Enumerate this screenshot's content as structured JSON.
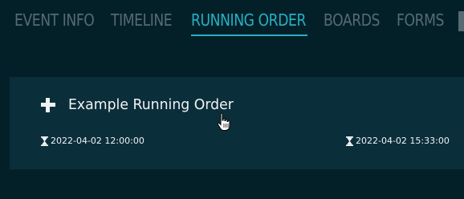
{
  "tabs": [
    {
      "label": "EVENT INFO",
      "active": false
    },
    {
      "label": "TIMELINE",
      "active": false
    },
    {
      "label": "RUNNING ORDER",
      "active": true
    },
    {
      "label": "BOARDS",
      "active": false
    },
    {
      "label": "FORMS",
      "active": false
    }
  ],
  "running_order": {
    "title": "Example Running Order",
    "start_time": "2022-04-02 12:00:00",
    "end_time": "2022-04-02 15:33:00"
  },
  "icons": {
    "add": "plus-icon",
    "time": "hourglass-icon",
    "cursor": "hand-pointer-cursor"
  },
  "colors": {
    "background": "#032029",
    "card": "#0b2e3b",
    "tab_inactive": "#566a72",
    "tab_active": "#27b0c3",
    "text": "#f0f3f4"
  }
}
